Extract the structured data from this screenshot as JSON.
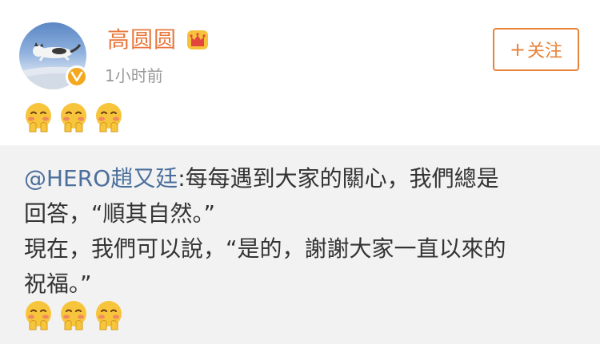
{
  "post": {
    "username": "高圆圆",
    "timestamp": "1小时前",
    "follow_label": "关注",
    "follow_plus": "+"
  },
  "icons": {
    "avatar_badge": "verified-v-icon",
    "crown": "crown-icon",
    "emoji": "shy-blush-emoji"
  },
  "repost": {
    "mention": "@HERO趙又廷",
    "line1_rest": ":每每遇到大家的關心，我們總是",
    "line2": "回答，“順其自然。”",
    "line3": "現在，我們可以說，“是的，謝謝大家一直以來的",
    "line4": "祝福。”"
  },
  "colors": {
    "username": "#e8773c",
    "mention": "#4a6f9c",
    "follow": "#e8833a",
    "repost_bg": "#f2f2f2",
    "badge": "#f3a81f"
  }
}
